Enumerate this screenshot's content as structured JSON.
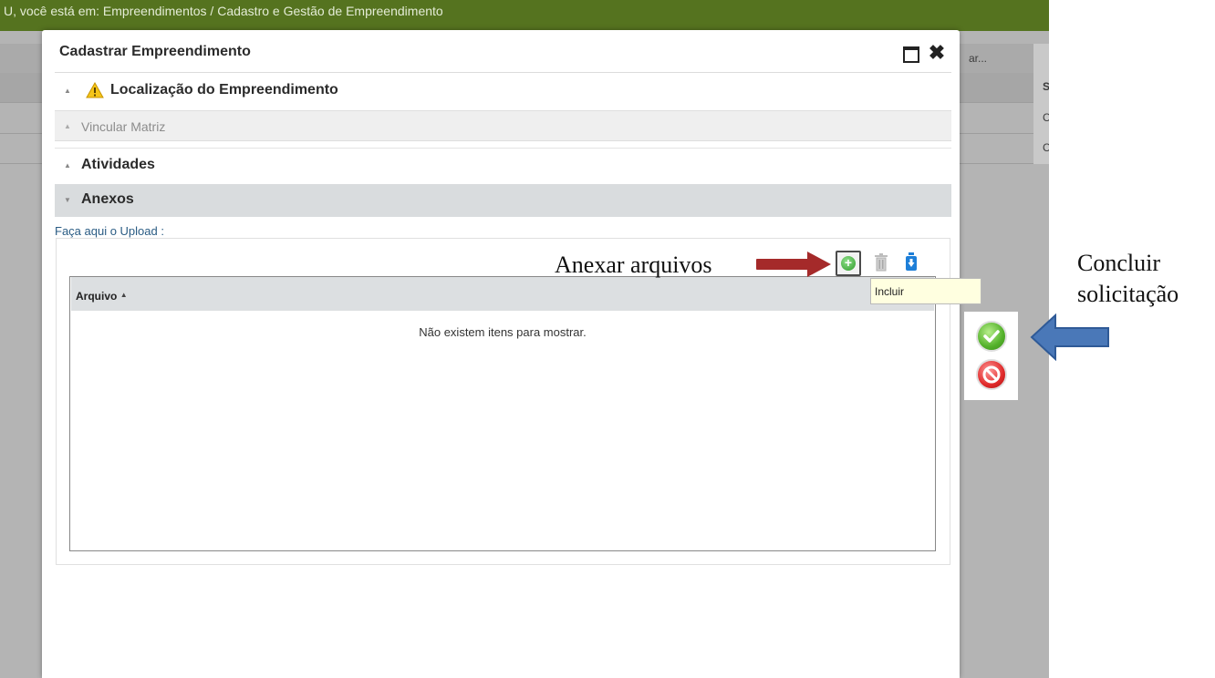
{
  "background": {
    "breadcrumb": "U, você está em: Empreendimentos / Cadastro e Gestão de Empreendimento",
    "truncated_button": "ar...",
    "col_header_letter": "S",
    "row_letters": [
      "C",
      "C"
    ]
  },
  "modal": {
    "title": "Cadastrar Empreendimento",
    "sections": [
      {
        "label": "Localização do Empreendimento",
        "state": "collapsed",
        "warning": true
      },
      {
        "label": "Vincular Matriz",
        "state": "disabled"
      },
      {
        "label": "Atividades",
        "state": "collapsed"
      },
      {
        "label": "Anexos",
        "state": "expanded"
      }
    ],
    "upload_label": "Faça aqui o Upload :",
    "toolbar": {
      "add_icon": "add-circle-icon",
      "delete_icon": "trash-icon",
      "download_icon": "download-icon",
      "tooltip": "Incluir"
    },
    "grid": {
      "column_header": "Arquivo",
      "empty_message": "Não existem itens para mostrar."
    }
  },
  "annotations": {
    "anexar": "Anexar arquivos",
    "concluir_line1": "Concluir",
    "concluir_line2": "solicitação"
  },
  "colors": {
    "topbar": "#55731f",
    "annotation_red_arrow": "#a52a2a",
    "annotation_blue_arrow": "#4a78b8",
    "link_blue": "#2a5c84"
  }
}
